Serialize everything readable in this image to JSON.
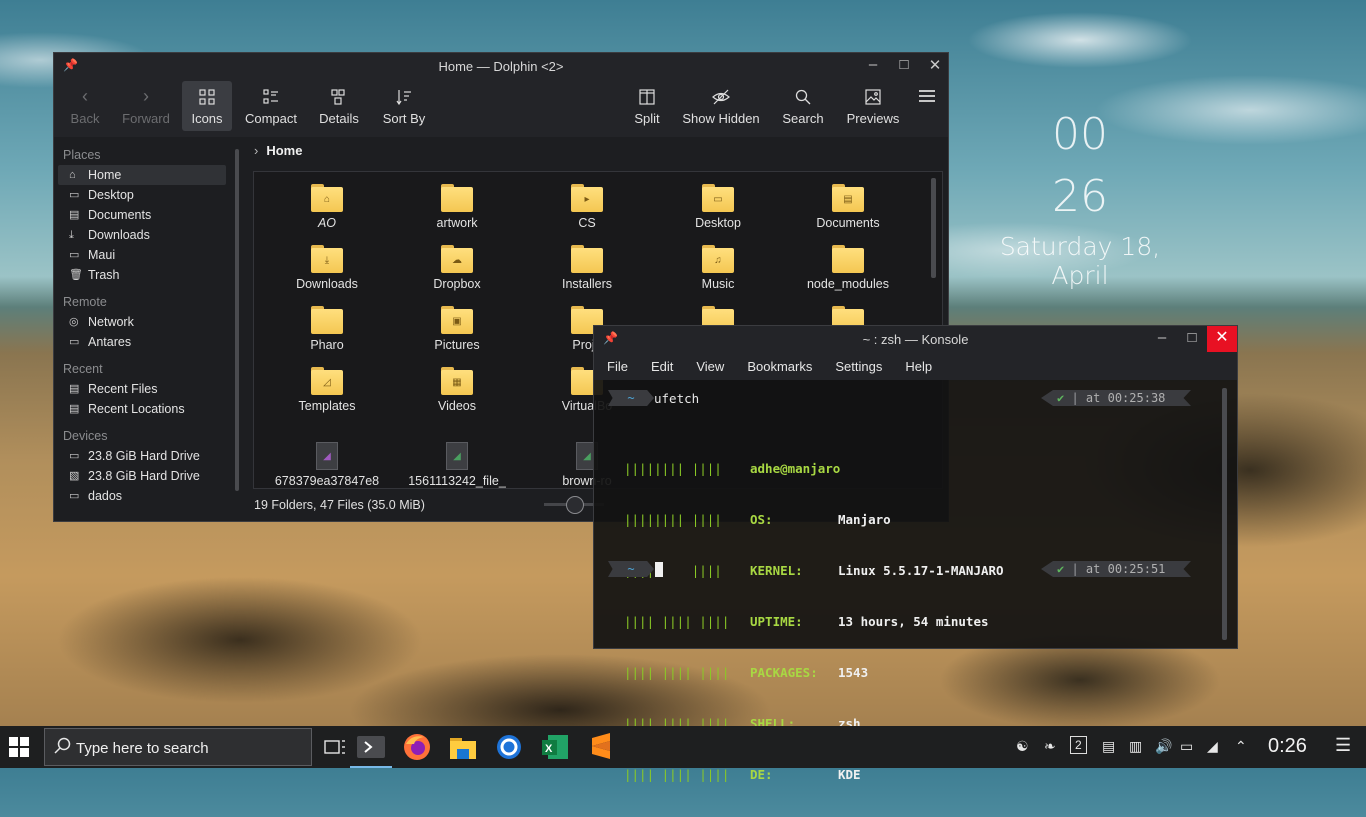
{
  "desktop": {
    "clock": {
      "hours": "00",
      "minutes": "26",
      "date": "Saturday 18, April"
    }
  },
  "dolphin": {
    "title": "Home — Dolphin <2>",
    "toolbar": {
      "back": "Back",
      "forward": "Forward",
      "icons": "Icons",
      "compact": "Compact",
      "details": "Details",
      "sort_by": "Sort By",
      "split": "Split",
      "show_hidden": "Show Hidden",
      "search": "Search",
      "previews": "Previews"
    },
    "sidebar": {
      "places_label": "Places",
      "places": [
        "Home",
        "Desktop",
        "Documents",
        "Downloads",
        "Maui",
        "Trash"
      ],
      "remote_label": "Remote",
      "remote": [
        "Network",
        "Antares"
      ],
      "recent_label": "Recent",
      "recent": [
        "Recent Files",
        "Recent Locations"
      ],
      "devices_label": "Devices",
      "devices": [
        "23.8 GiB Hard Drive",
        "23.8 GiB Hard Drive",
        "dados"
      ]
    },
    "breadcrumb": "Home",
    "files": [
      "AO",
      "artwork",
      "CS",
      "Desktop",
      "Documents",
      "Downloads",
      "Dropbox",
      "Installers",
      "Music",
      "node_modules",
      "Pharo",
      "Pictures",
      "Proje",
      "Templates",
      "Videos",
      "VirtualBo",
      "678379ea37847e8",
      "1561113242_file_",
      "brown-ro"
    ],
    "status": "19 Folders, 47 Files (35.0 MiB)"
  },
  "konsole": {
    "title": "~ : zsh — Konsole",
    "menu": [
      "File",
      "Edit",
      "View",
      "Bookmarks",
      "Settings",
      "Help"
    ],
    "prompt_dir": "~",
    "command": "ufetch",
    "status_1": "at 00:25:38",
    "status_2": "at 00:25:51",
    "bars": [
      "|||||||| ||||",
      "|||||||| ||||",
      "||||     ||||",
      "|||| |||| ||||",
      "|||| |||| ||||",
      "|||| |||| ||||",
      "|||| |||| ||||"
    ],
    "user_host": "adhe@manjaro",
    "info": [
      {
        "k": "OS:",
        "v": "Manjaro"
      },
      {
        "k": "KERNEL:",
        "v": "Linux 5.5.17-1-MANJARO"
      },
      {
        "k": "UPTIME:",
        "v": "13 hours, 54 minutes"
      },
      {
        "k": "PACKAGES:",
        "v": "1543"
      },
      {
        "k": "SHELL:",
        "v": "zsh"
      },
      {
        "k": "DE:",
        "v": "KDE"
      }
    ]
  },
  "taskbar": {
    "search_placeholder": "Type here to search",
    "desktop_number": "2",
    "time": "0:26"
  }
}
